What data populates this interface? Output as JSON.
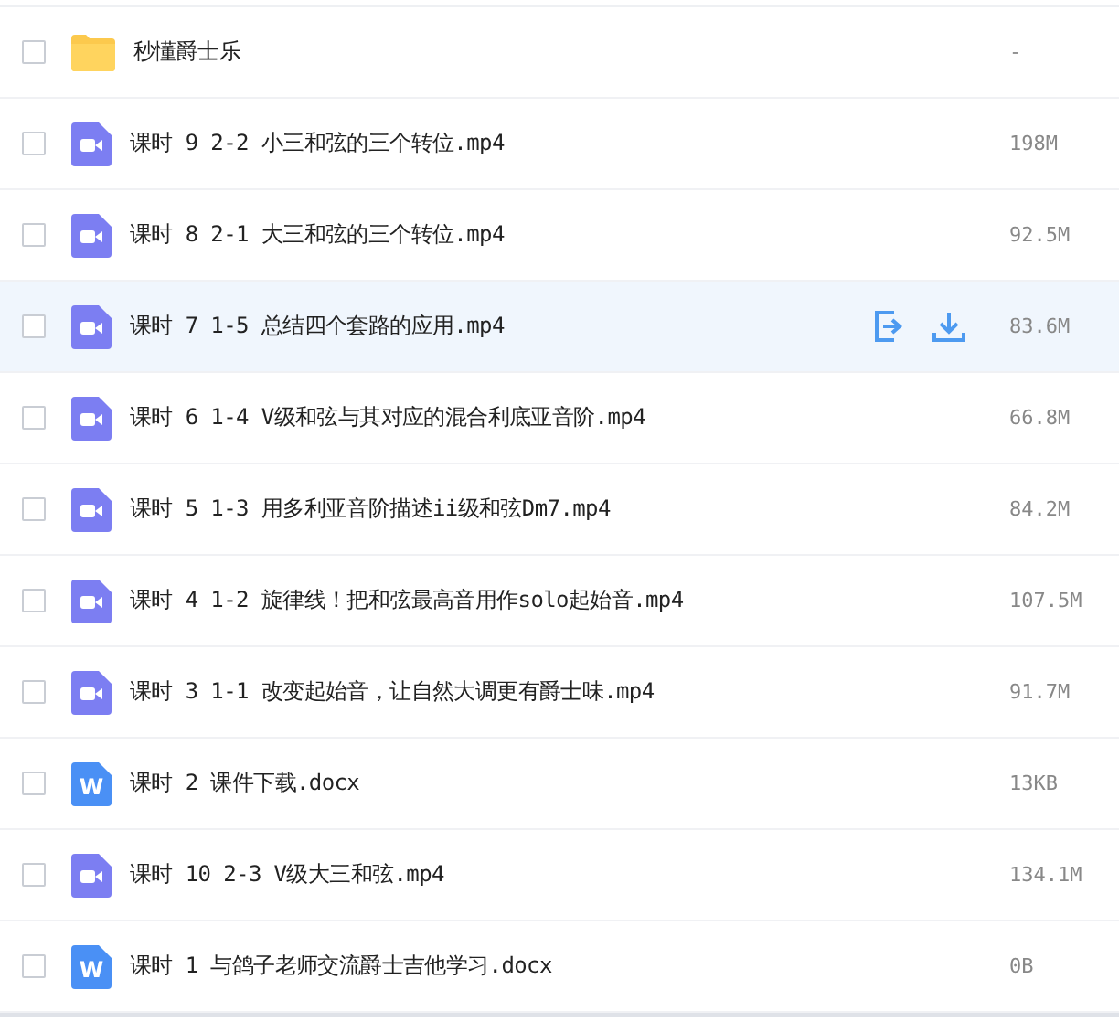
{
  "files": [
    {
      "kind": "folder",
      "name": "秒懂爵士乐",
      "size": "-",
      "checked": false,
      "hovered": false
    },
    {
      "kind": "video",
      "name": "课时 9 2-2 小三和弦的三个转位.mp4",
      "size": "198M",
      "checked": false,
      "hovered": false
    },
    {
      "kind": "video",
      "name": "课时 8 2-1 大三和弦的三个转位.mp4",
      "size": "92.5M",
      "checked": false,
      "hovered": false
    },
    {
      "kind": "video",
      "name": "课时 7 1-5 总结四个套路的应用.mp4",
      "size": "83.6M",
      "checked": false,
      "hovered": true
    },
    {
      "kind": "video",
      "name": "课时 6 1-4 V级和弦与其对应的混合利底亚音阶.mp4",
      "size": "66.8M",
      "checked": false,
      "hovered": false
    },
    {
      "kind": "video",
      "name": "课时 5 1-3 用多利亚音阶描述ii级和弦Dm7.mp4",
      "size": "84.2M",
      "checked": false,
      "hovered": false
    },
    {
      "kind": "video",
      "name": "课时 4 1-2 旋律线！把和弦最高音用作solo起始音.mp4",
      "size": "107.5M",
      "checked": false,
      "hovered": false
    },
    {
      "kind": "video",
      "name": "课时 3 1-1 改变起始音，让自然大调更有爵士味.mp4",
      "size": "91.7M",
      "checked": false,
      "hovered": false
    },
    {
      "kind": "doc",
      "badge": "W",
      "name": "课时 2 课件下载.docx",
      "size": "13KB",
      "checked": false,
      "hovered": false
    },
    {
      "kind": "video",
      "name": "课时 10 2-3 V级大三和弦.mp4",
      "size": "134.1M",
      "checked": false,
      "hovered": false
    },
    {
      "kind": "doc",
      "badge": "W",
      "name": "课时 1 与鸽子老师交流爵士吉他学习.docx",
      "size": "0B",
      "checked": false,
      "hovered": false
    }
  ]
}
